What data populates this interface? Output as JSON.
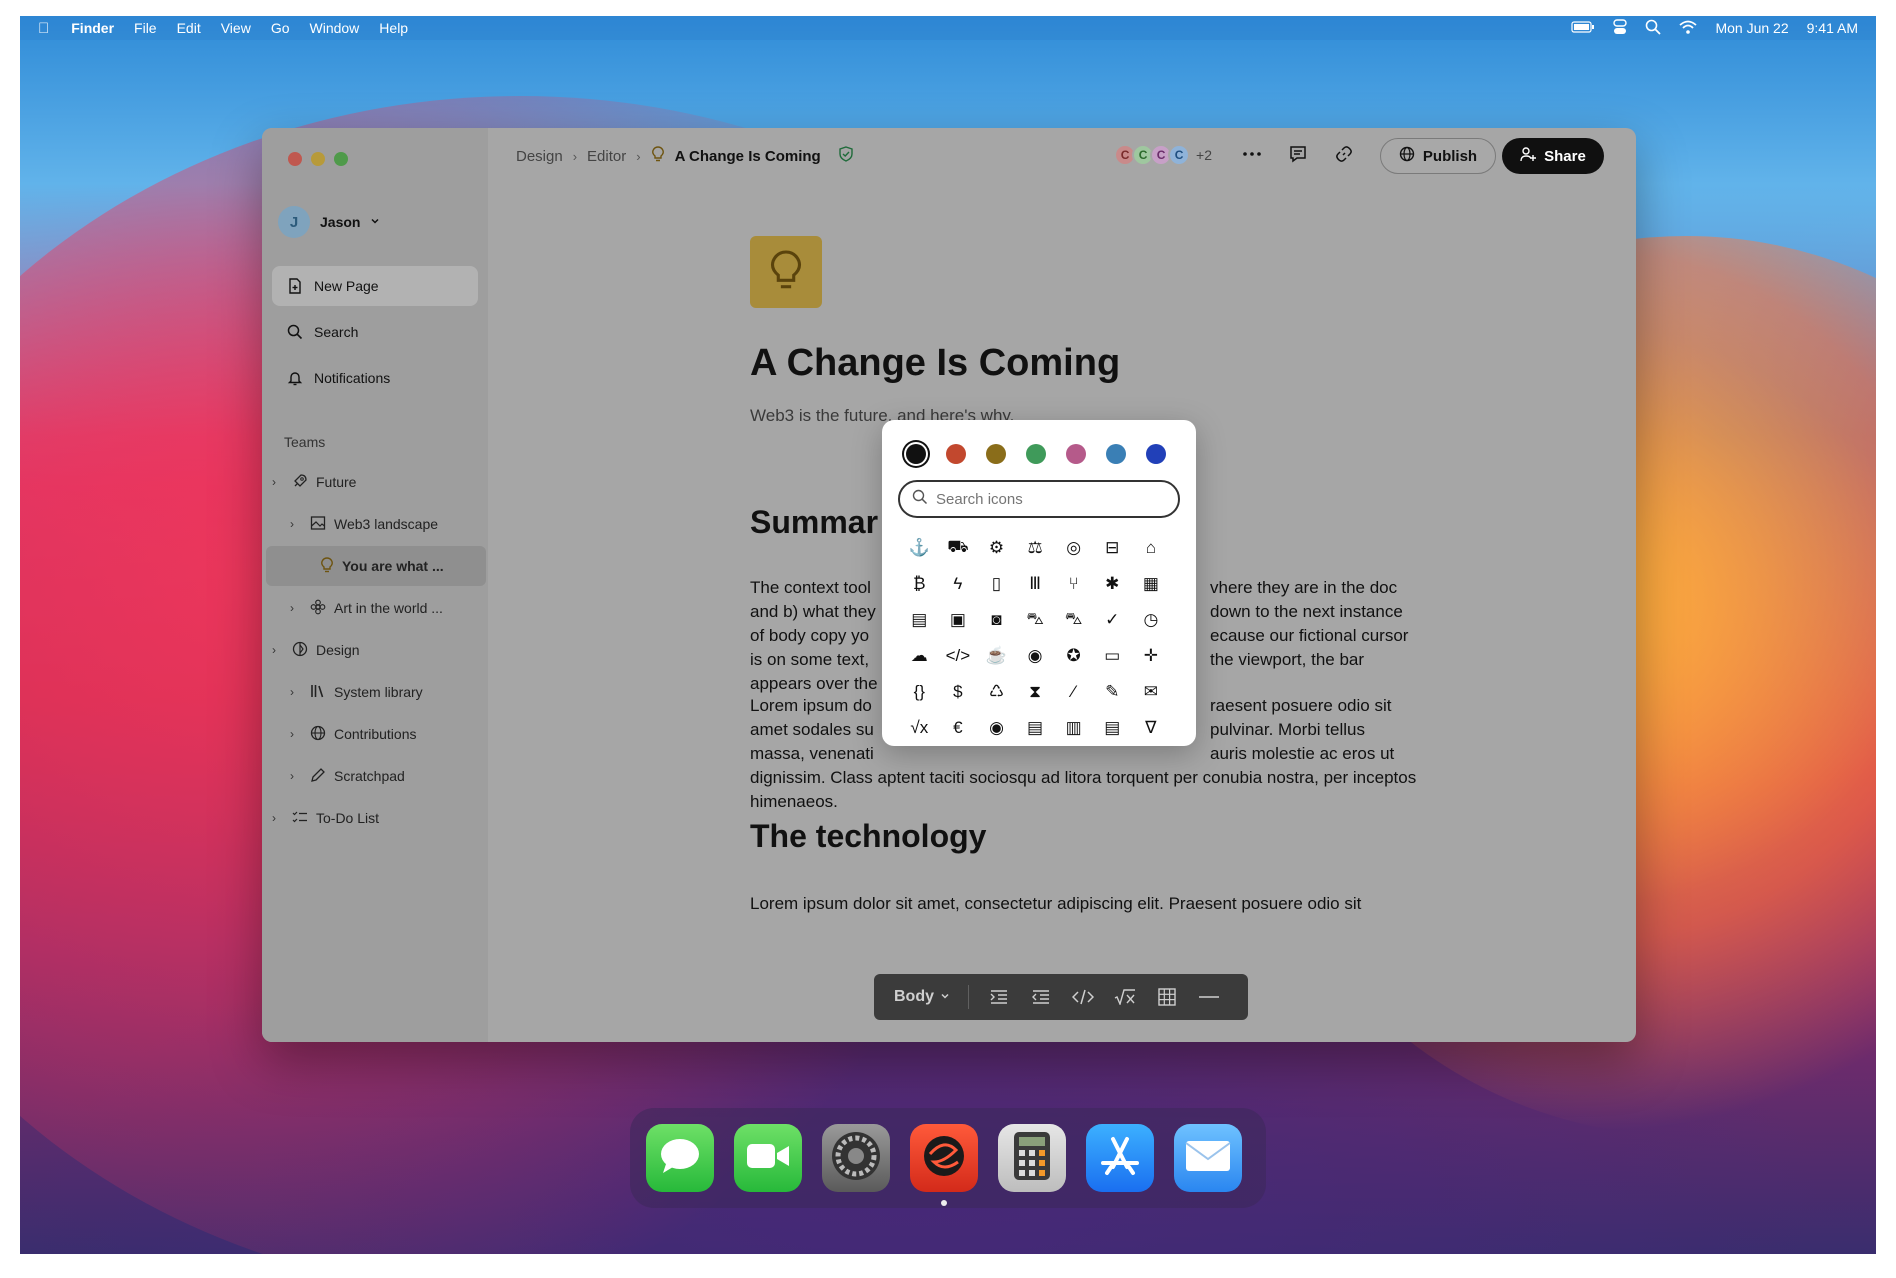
{
  "menubar": {
    "app": "Finder",
    "items": [
      "File",
      "Edit",
      "View",
      "Go",
      "Window",
      "Help"
    ],
    "date": "Mon Jun 22",
    "time": "9:41 AM"
  },
  "sidebar": {
    "user_initial": "J",
    "user_name": "Jason",
    "new_page": "New Page",
    "search": "Search",
    "notifications": "Notifications",
    "teams_label": "Teams",
    "tree": [
      {
        "label": "Future"
      },
      {
        "label": "Web3 landscape"
      },
      {
        "label": "You are what ..."
      },
      {
        "label": "Art in the world ..."
      },
      {
        "label": "Design"
      },
      {
        "label": "System library"
      },
      {
        "label": "Contributions"
      },
      {
        "label": "Scratchpad"
      },
      {
        "label": "To-Do List"
      }
    ]
  },
  "topbar": {
    "crumbs": [
      "Design",
      "Editor",
      "A Change Is Coming"
    ],
    "collaborators": [
      "C",
      "C",
      "C",
      "C"
    ],
    "collab_more": "+2",
    "publish": "Publish",
    "share": "Share"
  },
  "document": {
    "title": "A Change Is Coming",
    "subtitle": "Web3 is the future, and here's why.",
    "h_summary": "Summar",
    "p1_lines": [
      "The context tool",
      "and b) what they",
      "of body copy yo",
      "is on some text,",
      "appears over the"
    ],
    "p1_right_lines": [
      "vhere they are in the doc",
      "down to the next instance",
      "ecause our fictional cursor",
      "the viewport, the bar"
    ],
    "p2_lines": [
      "Lorem ipsum do",
      "amet sodales su",
      "massa, venenati"
    ],
    "p2_right_lines": [
      "raesent posuere odio sit",
      "pulvinar. Morbi tellus",
      "auris molestie ac eros ut"
    ],
    "p2_tail": "dignissim. Class aptent taciti sociosqu ad litora torquent per conubia nostra, per inceptos himenaeos.",
    "h_technology": "The technology",
    "p3": "Lorem ipsum dolor sit amet, consectetur adipiscing elit. Praesent posuere odio sit"
  },
  "toolbar": {
    "style": "Body"
  },
  "popover": {
    "colors": [
      "#111111",
      "#c2482e",
      "#8a6d1a",
      "#3f9a5a",
      "#b55a8a",
      "#3a7fb5",
      "#2140b8"
    ],
    "search_placeholder": "Search icons",
    "icons": [
      "⚓",
      "⛟",
      "⚙",
      "⚖",
      "◎",
      "⊟",
      "⌂",
      "₿",
      "ϟ",
      "▯",
      "Ⅲ",
      "⑂",
      "✱",
      "▦",
      "▤",
      "▣",
      "◙",
      "⛍",
      "⛍",
      "✓",
      "◷",
      "☁",
      "</>",
      "☕",
      "◉",
      "✪",
      "▭",
      "✛",
      "{}",
      "$",
      "♺",
      "⧗",
      "⁄",
      "✎",
      "✉",
      "√x",
      "€",
      "◉",
      "▤",
      "▥",
      "▤",
      "∇"
    ]
  },
  "dock": {
    "apps": [
      "messages-icon",
      "facetime-icon",
      "system-preferences-icon",
      "spline-icon",
      "calculator-icon",
      "app-store-icon",
      "mail-icon"
    ]
  }
}
